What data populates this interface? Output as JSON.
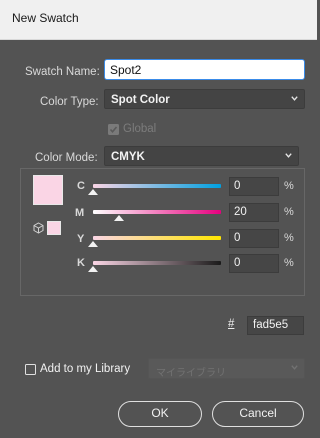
{
  "window": {
    "title": "New Swatch"
  },
  "swatch_name": {
    "label": "Swatch Name:",
    "value": "Spot2"
  },
  "color_type": {
    "label": "Color Type:",
    "value": "Spot Color"
  },
  "global": {
    "label": "Global",
    "checked": true,
    "enabled": false
  },
  "color_mode": {
    "label": "Color Mode:",
    "value": "CMYK"
  },
  "swatch_color": "#fad5e5",
  "sliders": [
    {
      "letter": "C",
      "value": "0",
      "unit": "%",
      "percent": 0
    },
    {
      "letter": "M",
      "value": "20",
      "unit": "%",
      "percent": 20
    },
    {
      "letter": "Y",
      "value": "0",
      "unit": "%",
      "percent": 0
    },
    {
      "letter": "K",
      "value": "0",
      "unit": "%",
      "percent": 0
    }
  ],
  "hex": {
    "symbol": "#",
    "value": "fad5e5"
  },
  "library": {
    "label": "Add to my Library",
    "checked": false,
    "dropdown_value": "マイライブラリ"
  },
  "buttons": {
    "ok": "OK",
    "cancel": "Cancel"
  },
  "colors": {
    "dialog_bg": "#535353",
    "focus_blue": "#3a8be8",
    "cyan": "#00a0e0",
    "magenta": "#e6007e",
    "yellow": "#ffe600",
    "black": "#1a1a1a"
  }
}
